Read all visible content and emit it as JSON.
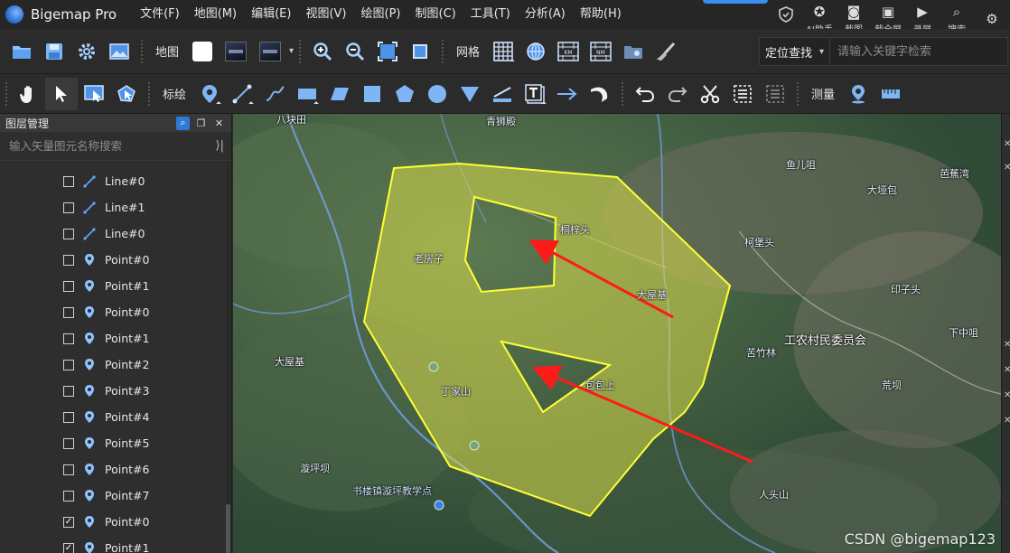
{
  "app": {
    "title": "Bigemap Pro"
  },
  "menu": [
    "文件(F)",
    "地图(M)",
    "编辑(E)",
    "视图(V)",
    "绘图(P)",
    "制图(C)",
    "工具(T)",
    "分析(A)",
    "帮助(H)"
  ],
  "top_right": [
    {
      "label": "AI助手",
      "icon": "ai-assistant-icon",
      "glyph": "✪"
    },
    {
      "label": "截图",
      "icon": "camera-icon",
      "glyph": "◙"
    },
    {
      "label": "截全屏",
      "icon": "monitor-icon",
      "glyph": "▣"
    },
    {
      "label": "录屏",
      "icon": "video-icon",
      "glyph": "▶"
    },
    {
      "label": "搜索",
      "icon": "search-icon",
      "glyph": "⌕"
    }
  ],
  "toolbar1": {
    "map_label": "地图",
    "grid_label": "网格",
    "locate_label": "定位查找",
    "search_placeholder": "请输入关键字检索"
  },
  "toolbar2": {
    "mark_label": "标绘",
    "measure_label": "测量"
  },
  "layer_panel": {
    "title": "图层管理",
    "search_placeholder": "输入矢量图元名称搜索",
    "items": [
      {
        "name": "Line#0",
        "type": "line",
        "checked": false
      },
      {
        "name": "Line#1",
        "type": "line",
        "checked": false
      },
      {
        "name": "Line#0",
        "type": "line",
        "checked": false
      },
      {
        "name": "Point#0",
        "type": "point",
        "checked": false
      },
      {
        "name": "Point#1",
        "type": "point",
        "checked": false
      },
      {
        "name": "Point#0",
        "type": "point",
        "checked": false
      },
      {
        "name": "Point#1",
        "type": "point",
        "checked": false
      },
      {
        "name": "Point#2",
        "type": "point",
        "checked": false
      },
      {
        "name": "Point#3",
        "type": "point",
        "checked": false
      },
      {
        "name": "Point#4",
        "type": "point",
        "checked": false
      },
      {
        "name": "Point#5",
        "type": "point",
        "checked": false
      },
      {
        "name": "Point#6",
        "type": "point",
        "checked": false
      },
      {
        "name": "Point#7",
        "type": "point",
        "checked": false
      },
      {
        "name": "Point#0",
        "type": "point",
        "checked": true
      },
      {
        "name": "Point#1",
        "type": "point",
        "checked": true
      }
    ]
  },
  "map": {
    "labels": [
      "八块田",
      "青狮殿",
      "鱼儿咀",
      "芭蕉湾",
      "大垭包",
      "桐梓头",
      "柯堡头",
      "老房子",
      "大屋基",
      "印子头",
      "工农村民委员会",
      "苦竹林",
      "下中咀",
      "大屋基",
      "丁家山",
      "包包上",
      "荒坝",
      "漩坪坝",
      "书楼镇漩坪教学点",
      "人头山"
    ],
    "colors": {
      "polygon_fill": "#e0e34a",
      "polygon_stroke": "#ffff33",
      "arrow": "#ff1a1a"
    }
  },
  "watermark": "CSDN @bigemap123"
}
